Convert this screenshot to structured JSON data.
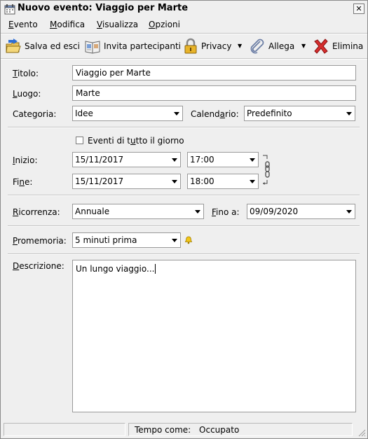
{
  "window": {
    "title": "Nuovo evento: Viaggio per Marte",
    "close_glyph": "✕"
  },
  "menu": [
    {
      "label": "Evento",
      "accesskey": "E"
    },
    {
      "label": "Modifica",
      "accesskey": "M"
    },
    {
      "label": "Visualizza",
      "accesskey": "V"
    },
    {
      "label": "Opzioni",
      "accesskey": "O"
    }
  ],
  "toolbar": {
    "save_label": "Salva ed esci",
    "invite_label": "Invita partecipanti",
    "privacy_label": "Privacy",
    "attach_label": "Allega",
    "delete_label": "Elimina"
  },
  "form": {
    "title_label": "Titolo:",
    "title_value": "Viaggio per Marte",
    "location_label": "Luogo:",
    "location_value": "Marte",
    "category_label": "Categoria:",
    "category_value": "Idee",
    "calendar_label": "Calendario:",
    "calendar_value": "Predefinito",
    "allday_label": "Eventi di tutto il giorno",
    "allday_checked": false,
    "start_label": "Inizio:",
    "start_date": "15/11/2017",
    "start_time": "17:00",
    "end_label": "Fine:",
    "end_date": "15/11/2017",
    "end_time": "18:00",
    "recurrence_label": "Ricorrenza:",
    "recurrence_value": "Annuale",
    "until_label": "Fino a:",
    "until_value": "09/09/2020",
    "reminder_label": "Promemoria:",
    "reminder_value": "5 minuti prima",
    "description_label": "Descrizione:",
    "description_value": "Un lungo viaggio..."
  },
  "status": {
    "show_as_label": "Tempo come:",
    "show_as_value": "Occupato"
  },
  "icons": [
    "calendar-icon",
    "close-icon",
    "save-icon",
    "invite-icon",
    "lock-icon",
    "paperclip-icon",
    "delete-x-icon",
    "link-chain-icon",
    "bell-icon",
    "resize-grip-icon"
  ]
}
